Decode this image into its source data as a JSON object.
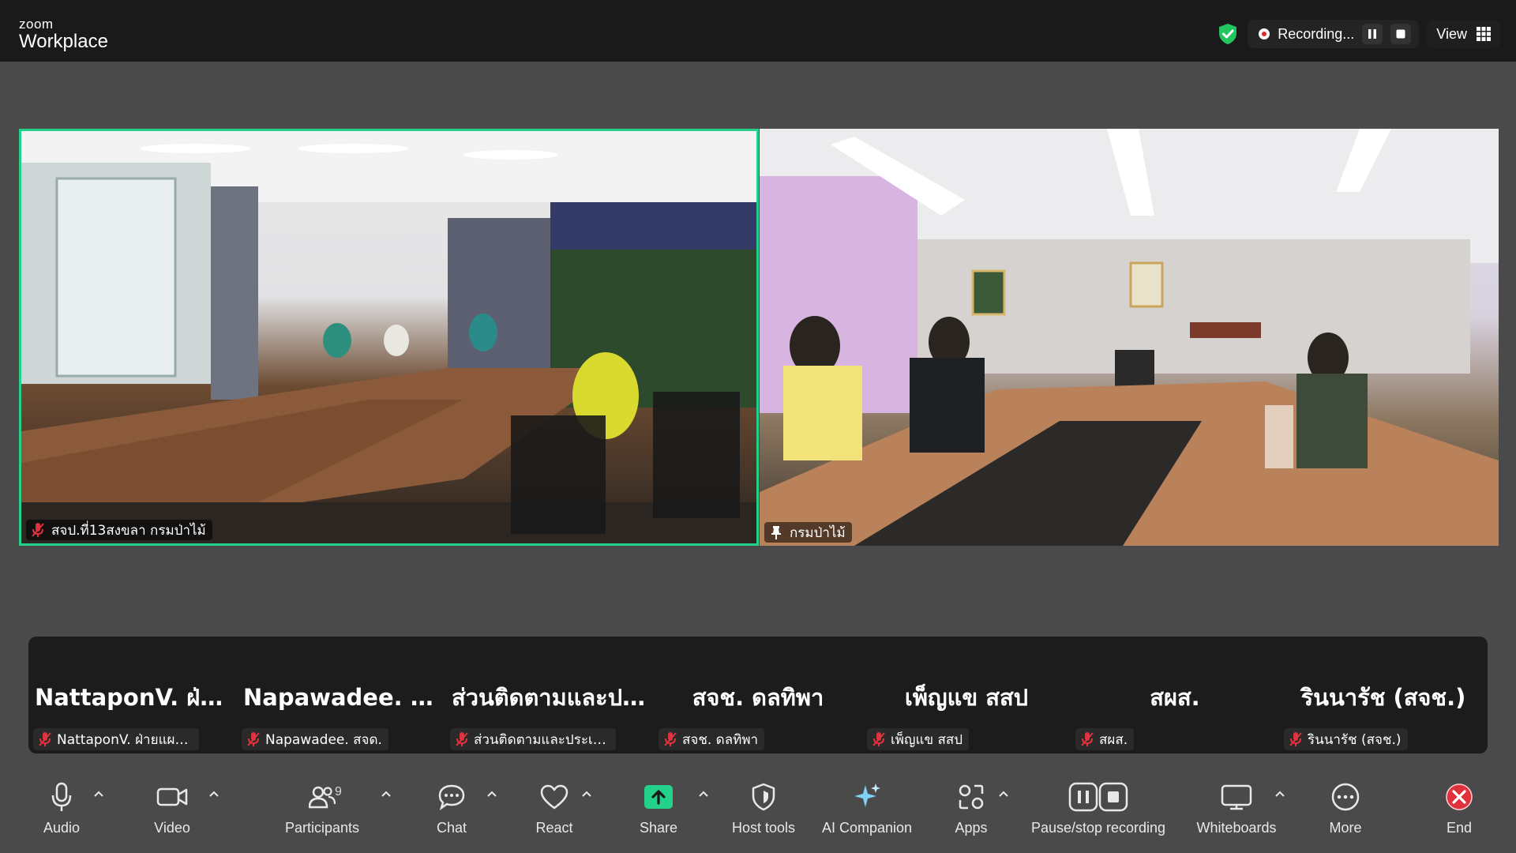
{
  "brand": {
    "line1": "zoom",
    "line2": "Workplace"
  },
  "top_right": {
    "recording_label": "Recording...",
    "view_label": "View"
  },
  "tiles": [
    {
      "name": "สจป.ที่13สงขลา กรมป่าไม้",
      "status": "muted"
    },
    {
      "name": "กรมป่าไม้",
      "status": "pinned"
    }
  ],
  "participants": [
    {
      "big_name": "NattaponV. ฝ่าย...",
      "label": "NattaponV. ฝ่ายแผน..."
    },
    {
      "big_name": "Napawadee. สจด.",
      "label": "Napawadee. สจด."
    },
    {
      "big_name": "ส่วนติดตามและป...",
      "label": "ส่วนติดตามและประเมิ..."
    },
    {
      "big_name": "สจช. ดลทิพา",
      "label": "สจช. ดลทิพา"
    },
    {
      "big_name": "เพ็ญแข สสป",
      "label": "เพ็ญแข สสป"
    },
    {
      "big_name": "สผส.",
      "label": "สผส."
    },
    {
      "big_name": "รินนารัช (สจช.)",
      "label": "รินนารัช (สจช.)"
    }
  ],
  "toolbar": {
    "audio": "Audio",
    "video": "Video",
    "participants": "Participants",
    "participants_count": "9",
    "chat": "Chat",
    "react": "React",
    "share": "Share",
    "host_tools": "Host tools",
    "ai_companion": "AI Companion",
    "apps": "Apps",
    "pause_recording": "Pause/stop recording",
    "whiteboards": "Whiteboards",
    "more": "More",
    "end": "End"
  },
  "colors": {
    "active_speaker_border": "#23d18b",
    "share_green": "#23d18b",
    "end_red": "#e0323c",
    "shield_green": "#22c55e"
  }
}
